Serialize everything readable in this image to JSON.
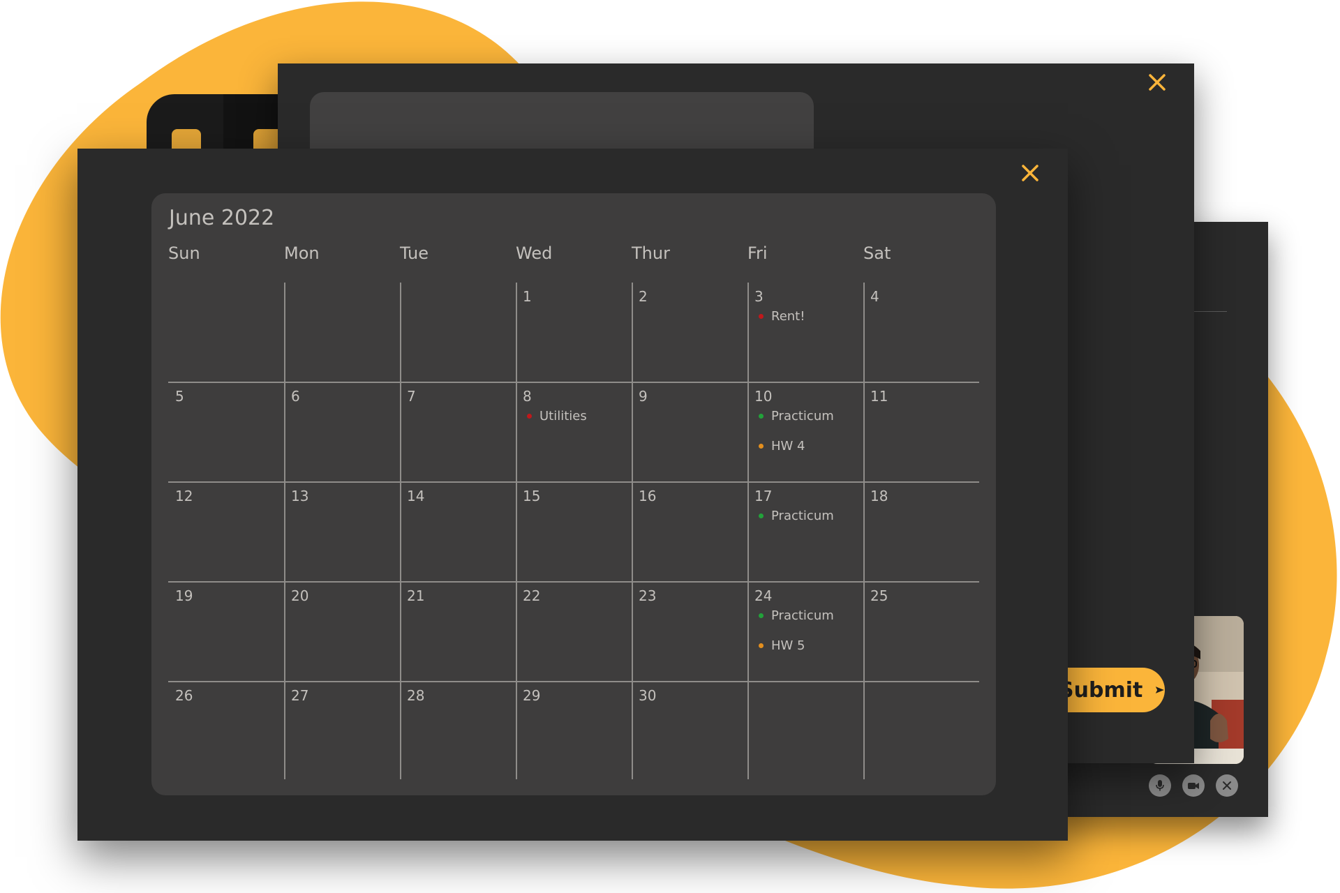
{
  "background": {
    "blob_color": "#fbb53a"
  },
  "tile": {
    "accent": "#e3a537"
  },
  "form_window": {
    "close_icon": "x-icon",
    "submit_label": "Submit",
    "submit_icon": "send-arrow-icon",
    "submit_color": "#fbb53a"
  },
  "call_window": {
    "controls": [
      {
        "name": "mic-icon"
      },
      {
        "name": "camera-icon"
      },
      {
        "name": "end-call-icon"
      }
    ]
  },
  "calendar": {
    "title": "June 2022",
    "close_icon": "x-icon",
    "accent": "#fbb53a",
    "weekdays": [
      "Sun",
      "Mon",
      "Tue",
      "Wed",
      "Thur",
      "Fri",
      "Sat"
    ],
    "weeks": [
      [
        {
          "day": ""
        },
        {
          "day": ""
        },
        {
          "day": ""
        },
        {
          "day": "1"
        },
        {
          "day": "2"
        },
        {
          "day": "3",
          "events": [
            {
              "label": "Rent!",
              "color": "#c0181b"
            }
          ]
        },
        {
          "day": "4"
        }
      ],
      [
        {
          "day": "5"
        },
        {
          "day": "6"
        },
        {
          "day": "7"
        },
        {
          "day": "8",
          "events": [
            {
              "label": "Utilities",
              "color": "#c0181b"
            }
          ]
        },
        {
          "day": "9"
        },
        {
          "day": "10",
          "events": [
            {
              "label": "Practicum",
              "color": "#22a23a"
            },
            {
              "label": "HW 4",
              "color": "#e38f1e"
            }
          ]
        },
        {
          "day": "11"
        }
      ],
      [
        {
          "day": "12"
        },
        {
          "day": "13"
        },
        {
          "day": "14"
        },
        {
          "day": "15"
        },
        {
          "day": "16"
        },
        {
          "day": "17",
          "events": [
            {
              "label": "Practicum",
              "color": "#22a23a"
            }
          ]
        },
        {
          "day": "18"
        }
      ],
      [
        {
          "day": "19"
        },
        {
          "day": "20"
        },
        {
          "day": "21"
        },
        {
          "day": "22"
        },
        {
          "day": "23"
        },
        {
          "day": "24",
          "events": [
            {
              "label": "Practicum",
              "color": "#22a23a"
            },
            {
              "label": "HW 5",
              "color": "#e38f1e"
            }
          ]
        },
        {
          "day": "25"
        }
      ],
      [
        {
          "day": "26"
        },
        {
          "day": "27"
        },
        {
          "day": "28"
        },
        {
          "day": "29"
        },
        {
          "day": "30"
        },
        {
          "day": ""
        },
        {
          "day": ""
        }
      ]
    ]
  }
}
